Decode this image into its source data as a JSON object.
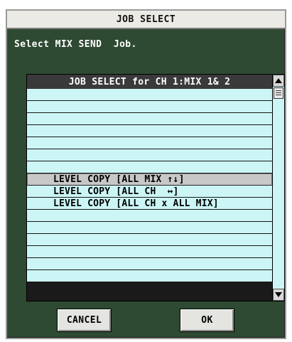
{
  "dialog": {
    "title": "JOB SELECT",
    "instruction": "Select MIX SEND  Job."
  },
  "list": {
    "header": "JOB SELECT for CH 1:MIX 1& 2",
    "rows": [
      "",
      "",
      "",
      "",
      "",
      "",
      "",
      "LEVEL COPY [ALL MIX ↑↓]",
      "LEVEL COPY [ALL CH  ↔]",
      "LEVEL COPY [ALL CH x ALL MIX]",
      "",
      "",
      "",
      "",
      "",
      ""
    ],
    "selected_index": 7
  },
  "buttons": {
    "cancel": "CANCEL",
    "ok": "OK"
  },
  "icons": {
    "scroll_up": "up-arrow-icon",
    "scroll_down": "down-arrow-icon",
    "scroll_thumb": "grip-icon"
  },
  "colors": {
    "window_bg": "#2e4a32",
    "row_bg": "#ccf6f6",
    "selected_bg": "#c8c8c8",
    "header_bg": "#3a3a3a"
  }
}
